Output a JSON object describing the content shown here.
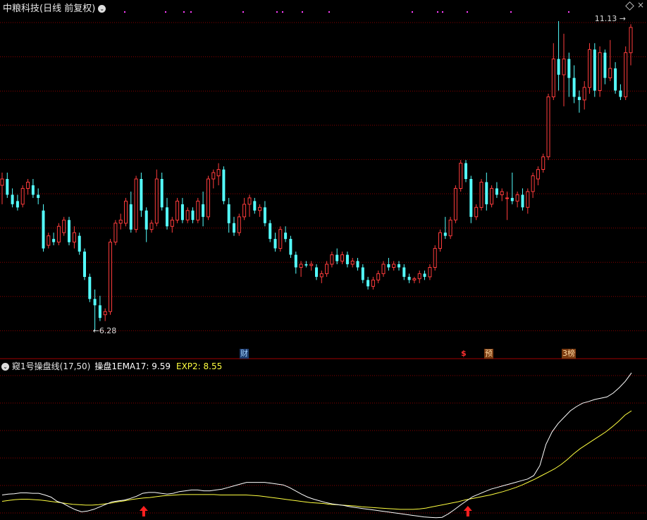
{
  "header": {
    "title": "中粮科技(日线 前复权)",
    "high_label": "11.13",
    "low_label": "6.28"
  },
  "indicator": {
    "name": "窥1号操盘线(17,50)",
    "line1_label": "操盘1EMA17:",
    "line1_value": "9.59",
    "line2_label": "EXP2:",
    "line2_value": "8.55"
  },
  "events": [
    {
      "label": "财",
      "kind": "cai"
    },
    {
      "label": "$",
      "kind": "dollar"
    },
    {
      "label": "预",
      "kind": "yu"
    },
    {
      "label": "3榜",
      "kind": "bang"
    }
  ],
  "colors": {
    "up": "#ff3c3c",
    "down": "#54ffff",
    "grid": "#8a0000",
    "line1": "#ffffff",
    "line2": "#ffff40",
    "signal": "#ff2020"
  },
  "icons": [
    "dropdown-icon",
    "diamond-icon",
    "close-icon",
    "up-arrow-icon"
  ],
  "chart_data": {
    "type": "candlestick",
    "price_range": [
      6.0,
      11.4
    ],
    "candles": [
      [
        8.6,
        8.8,
        8.3,
        8.7
      ],
      [
        8.7,
        8.8,
        8.4,
        8.45
      ],
      [
        8.45,
        8.55,
        8.25,
        8.3
      ],
      [
        8.35,
        8.45,
        8.2,
        8.25
      ],
      [
        8.3,
        8.6,
        8.25,
        8.55
      ],
      [
        8.55,
        8.7,
        8.45,
        8.65
      ],
      [
        8.6,
        8.7,
        8.4,
        8.45
      ],
      [
        8.45,
        8.55,
        8.3,
        8.4
      ],
      [
        8.2,
        8.3,
        7.55,
        7.6
      ],
      [
        7.65,
        7.85,
        7.6,
        7.8
      ],
      [
        7.75,
        7.85,
        7.65,
        7.7
      ],
      [
        7.7,
        8.0,
        7.65,
        7.95
      ],
      [
        7.85,
        8.1,
        7.8,
        8.05
      ],
      [
        8.05,
        8.1,
        7.65,
        7.7
      ],
      [
        7.7,
        7.95,
        7.6,
        7.85
      ],
      [
        7.8,
        7.85,
        7.5,
        7.55
      ],
      [
        7.55,
        7.6,
        7.1,
        7.15
      ],
      [
        7.15,
        7.2,
        6.75,
        6.8
      ],
      [
        6.8,
        6.95,
        6.3,
        6.7
      ],
      [
        6.7,
        6.85,
        6.45,
        6.5
      ],
      [
        6.55,
        6.65,
        6.45,
        6.6
      ],
      [
        6.6,
        7.75,
        6.55,
        7.7
      ],
      [
        7.7,
        8.05,
        7.65,
        8.0
      ],
      [
        8.0,
        8.15,
        7.9,
        8.05
      ],
      [
        8.0,
        8.4,
        7.95,
        8.35
      ],
      [
        8.3,
        8.5,
        7.85,
        7.9
      ],
      [
        7.9,
        8.75,
        7.85,
        8.7
      ],
      [
        8.7,
        8.8,
        8.1,
        8.2
      ],
      [
        8.2,
        8.25,
        7.7,
        7.9
      ],
      [
        7.9,
        8.05,
        7.85,
        8.0
      ],
      [
        8.0,
        8.85,
        7.95,
        8.7
      ],
      [
        8.7,
        8.8,
        8.2,
        8.25
      ],
      [
        8.25,
        8.4,
        7.9,
        7.95
      ],
      [
        7.95,
        8.1,
        7.85,
        8.05
      ],
      [
        8.05,
        8.4,
        8.0,
        8.35
      ],
      [
        8.3,
        8.4,
        8.0,
        8.05
      ],
      [
        8.05,
        8.25,
        8.0,
        8.2
      ],
      [
        8.2,
        8.25,
        8.0,
        8.05
      ],
      [
        8.05,
        8.4,
        8.0,
        8.35
      ],
      [
        8.3,
        8.5,
        7.95,
        8.1
      ],
      [
        8.1,
        8.75,
        8.05,
        8.7
      ],
      [
        8.7,
        8.85,
        8.55,
        8.8
      ],
      [
        8.75,
        8.95,
        8.6,
        8.85
      ],
      [
        8.85,
        8.9,
        8.3,
        8.35
      ],
      [
        8.3,
        8.4,
        7.85,
        8.0
      ],
      [
        8.0,
        8.1,
        7.8,
        7.85
      ],
      [
        7.85,
        8.15,
        7.8,
        8.1
      ],
      [
        8.1,
        8.4,
        8.05,
        8.3
      ],
      [
        8.3,
        8.45,
        8.1,
        8.4
      ],
      [
        8.35,
        8.4,
        8.15,
        8.2
      ],
      [
        8.2,
        8.3,
        8.1,
        8.25
      ],
      [
        8.25,
        8.35,
        7.95,
        8.0
      ],
      [
        8.0,
        8.05,
        7.7,
        7.75
      ],
      [
        7.75,
        7.85,
        7.55,
        7.6
      ],
      [
        7.6,
        7.95,
        7.55,
        7.9
      ],
      [
        7.85,
        7.95,
        7.7,
        7.75
      ],
      [
        7.75,
        7.8,
        7.45,
        7.5
      ],
      [
        7.5,
        7.55,
        7.2,
        7.3
      ],
      [
        7.3,
        7.4,
        7.15,
        7.35
      ],
      [
        7.35,
        7.4,
        7.3,
        7.33
      ],
      [
        7.33,
        7.4,
        7.25,
        7.35
      ],
      [
        7.3,
        7.35,
        7.1,
        7.15
      ],
      [
        7.15,
        7.25,
        7.05,
        7.2
      ],
      [
        7.2,
        7.4,
        7.15,
        7.35
      ],
      [
        7.35,
        7.55,
        7.3,
        7.5
      ],
      [
        7.5,
        7.6,
        7.35,
        7.4
      ],
      [
        7.4,
        7.55,
        7.35,
        7.5
      ],
      [
        7.5,
        7.55,
        7.3,
        7.35
      ],
      [
        7.35,
        7.45,
        7.3,
        7.4
      ],
      [
        7.4,
        7.45,
        7.25,
        7.3
      ],
      [
        7.3,
        7.35,
        7.05,
        7.1
      ],
      [
        7.1,
        7.15,
        6.95,
        7.0
      ],
      [
        7.0,
        7.15,
        6.95,
        7.1
      ],
      [
        7.1,
        7.25,
        7.05,
        7.2
      ],
      [
        7.2,
        7.4,
        7.15,
        7.35
      ],
      [
        7.35,
        7.45,
        7.25,
        7.3
      ],
      [
        7.3,
        7.4,
        7.25,
        7.35
      ],
      [
        7.35,
        7.4,
        7.25,
        7.3
      ],
      [
        7.3,
        7.35,
        7.1,
        7.15
      ],
      [
        7.15,
        7.2,
        7.05,
        7.1
      ],
      [
        7.1,
        7.15,
        7.05,
        7.12
      ],
      [
        7.12,
        7.25,
        7.05,
        7.2
      ],
      [
        7.2,
        7.25,
        7.1,
        7.15
      ],
      [
        7.15,
        7.35,
        7.1,
        7.3
      ],
      [
        7.3,
        7.65,
        7.25,
        7.6
      ],
      [
        7.6,
        7.9,
        7.55,
        7.85
      ],
      [
        7.85,
        8.1,
        7.75,
        7.8
      ],
      [
        7.8,
        8.1,
        7.75,
        8.05
      ],
      [
        8.05,
        8.6,
        8.0,
        8.55
      ],
      [
        8.55,
        9.0,
        8.5,
        8.95
      ],
      [
        8.95,
        9.0,
        8.65,
        8.7
      ],
      [
        8.7,
        8.75,
        8.0,
        8.1
      ],
      [
        8.1,
        8.3,
        8.05,
        8.25
      ],
      [
        8.25,
        8.7,
        8.2,
        8.65
      ],
      [
        8.65,
        8.8,
        8.2,
        8.3
      ],
      [
        8.3,
        8.6,
        8.25,
        8.55
      ],
      [
        8.55,
        8.65,
        8.4,
        8.45
      ],
      [
        8.45,
        8.55,
        8.35,
        8.5
      ],
      [
        8.4,
        8.5,
        8.05,
        8.4
      ],
      [
        8.4,
        8.8,
        8.3,
        8.35
      ],
      [
        8.35,
        8.5,
        8.25,
        8.45
      ],
      [
        8.45,
        8.55,
        8.2,
        8.25
      ],
      [
        8.25,
        8.55,
        8.15,
        8.5
      ],
      [
        8.5,
        8.8,
        8.4,
        8.75
      ],
      [
        8.7,
        8.9,
        8.6,
        8.85
      ],
      [
        8.85,
        9.1,
        8.8,
        9.05
      ],
      [
        9.05,
        10.05,
        9.0,
        10.0
      ],
      [
        10.0,
        10.85,
        9.95,
        10.6
      ],
      [
        10.6,
        11.2,
        10.1,
        10.35
      ],
      [
        10.35,
        11.0,
        9.85,
        10.6
      ],
      [
        10.6,
        10.7,
        10.0,
        10.3
      ],
      [
        10.3,
        10.5,
        9.9,
        10.0
      ],
      [
        10.0,
        10.1,
        9.75,
        9.95
      ],
      [
        9.95,
        10.25,
        9.8,
        10.15
      ],
      [
        10.15,
        10.85,
        10.05,
        10.75
      ],
      [
        10.75,
        10.85,
        10.0,
        10.1
      ],
      [
        10.1,
        10.8,
        10.0,
        10.7
      ],
      [
        10.7,
        10.75,
        10.2,
        10.3
      ],
      [
        10.3,
        10.9,
        10.25,
        10.45
      ],
      [
        10.45,
        10.55,
        10.05,
        10.1
      ],
      [
        10.1,
        10.2,
        9.95,
        10.0
      ],
      [
        10.0,
        10.8,
        9.95,
        10.7
      ],
      [
        10.7,
        11.15,
        10.5,
        11.1
      ]
    ],
    "ema17": [
      8.0,
      8.02,
      8.03,
      8.05,
      8.05,
      8.04,
      8.04,
      8.0,
      7.95,
      7.85,
      7.8,
      7.72,
      7.65,
      7.6,
      7.62,
      7.66,
      7.72,
      7.78,
      7.84,
      7.86,
      7.88,
      7.92,
      7.97,
      8.04,
      8.06,
      8.06,
      8.04,
      8.02,
      8.04,
      8.08,
      8.1,
      8.12,
      8.12,
      8.1,
      8.1,
      8.12,
      8.14,
      8.18,
      8.22,
      8.26,
      8.3,
      8.3,
      8.3,
      8.3,
      8.28,
      8.26,
      8.24,
      8.18,
      8.1,
      8.02,
      7.95,
      7.9,
      7.86,
      7.82,
      7.79,
      7.77,
      7.75,
      7.72,
      7.7,
      7.68,
      7.66,
      7.64,
      7.62,
      7.6,
      7.58,
      7.56,
      7.54,
      7.52,
      7.5,
      7.48,
      7.47,
      7.46,
      7.47,
      7.55,
      7.65,
      7.76,
      7.86,
      7.96,
      8.02,
      8.08,
      8.14,
      8.18,
      8.22,
      8.26,
      8.3,
      8.34,
      8.38,
      8.46,
      8.7,
      9.2,
      9.5,
      9.7,
      9.85,
      10.0,
      10.1,
      10.18,
      10.22,
      10.27,
      10.3,
      10.33,
      10.42,
      10.55,
      10.7,
      10.9
    ],
    "exp2": [
      7.85,
      7.87,
      7.89,
      7.9,
      7.9,
      7.89,
      7.88,
      7.86,
      7.84,
      7.82,
      7.8,
      7.78,
      7.77,
      7.76,
      7.76,
      7.77,
      7.79,
      7.81,
      7.84,
      7.86,
      7.89,
      7.91,
      7.93,
      7.94,
      7.96,
      7.98,
      7.99,
      8.0,
      8.01,
      8.01,
      8.01,
      8.01,
      8.01,
      8.01,
      8.0,
      8.0,
      8.0,
      8.0,
      8.0,
      7.99,
      7.98,
      7.96,
      7.94,
      7.92,
      7.9,
      7.88,
      7.86,
      7.84,
      7.82,
      7.81,
      7.8,
      7.78,
      7.77,
      7.76,
      7.75,
      7.74,
      7.72,
      7.71,
      7.7,
      7.69,
      7.68,
      7.67,
      7.66,
      7.66,
      7.66,
      7.67,
      7.69,
      7.72,
      7.75,
      7.78,
      7.81,
      7.84,
      7.88,
      7.91,
      7.94,
      7.97,
      8.0,
      8.04,
      8.08,
      8.13,
      8.18,
      8.24,
      8.31,
      8.38,
      8.46,
      8.54,
      8.62,
      8.72,
      8.84,
      8.98,
      9.1,
      9.2,
      9.3,
      9.4,
      9.5,
      9.62,
      9.75,
      9.9,
      10.0
    ],
    "signals": [
      {
        "type": "buy",
        "at": 0.225
      },
      {
        "type": "buy",
        "at": 0.74
      }
    ]
  }
}
